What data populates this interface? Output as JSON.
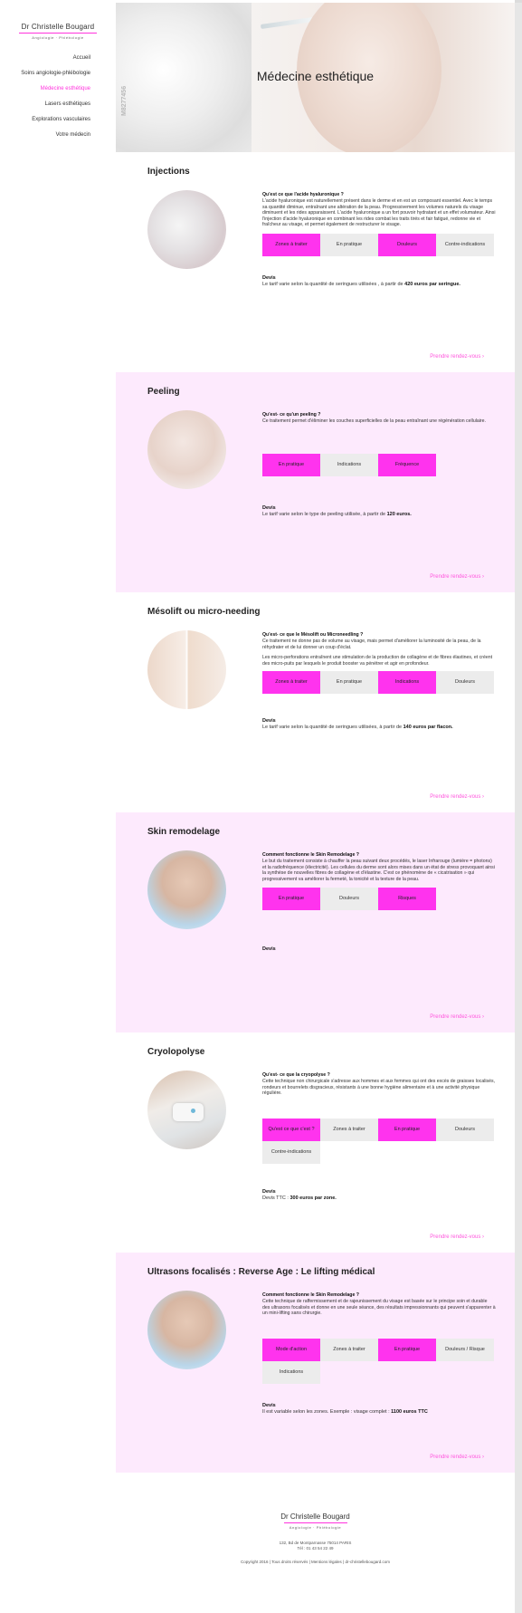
{
  "brand": {
    "name": "Dr Christelle Bougard",
    "subtitle": "Angiologie · Phlébologie"
  },
  "nav": [
    {
      "label": "Accueil"
    },
    {
      "label": "Soins angiologie-phlébologie"
    },
    {
      "label": "Médecine esthétique"
    },
    {
      "label": "Lasers esthétiques"
    },
    {
      "label": "Explorations vasculaires"
    },
    {
      "label": "Votre médecin"
    }
  ],
  "hero": {
    "title": "Médecine esthétique",
    "watermark": "M8277456"
  },
  "sections": [
    {
      "title": "Injections",
      "question": "Qu'est ce que l'acide hyaluronique ?",
      "paragraphs": [
        "L'acide hyaluronique est naturellement présent dans le derme et en est un composant essentiel. Avec le temps sa quantité diminue, entraînant une altération de la peau. Progressivement les volumes naturels du visage diminuent et les rides apparaissent. L'acide hyaluronique a un fort pouvoir hydratant et un effet volumateur. Ainsi l'injection d'acide hyaluronique en combinant les rides combat les traits tirés et fair fatigué, redonne vie et fraîcheur au visage, et permet également de restructurer le visage."
      ],
      "tabs": [
        "Zones à traiter",
        "En pratique",
        "Douleurs",
        "Contre-indications"
      ],
      "devis_title": "Devis",
      "devis_text": "Le tarif varie selon la quantité de seringues utilisées , à partir de",
      "devis_bold": "420 euros par seringue.",
      "cta": "Prendre rendez-vous ›"
    },
    {
      "title": "Peeling",
      "question": "Qu'est- ce qu'un peeling ?",
      "paragraphs": [
        "Ce traitement permet d'éliminer les couches superficielles de la peau entraînant une régénération cellulaire."
      ],
      "tabs": [
        "En pratique",
        "Indications",
        "Fréquence"
      ],
      "devis_title": "Devis",
      "devis_text": "Le tarif varie selon le type de peeling utilisée, à partir de",
      "devis_bold": "120 euros.",
      "cta": "Prendre rendez-vous ›"
    },
    {
      "title": "Mésolift ou micro-needing",
      "question": "Qu'est- ce que le Mésolift ou Microneedling ?",
      "paragraphs": [
        "Ce traitement ne donne pas de volume au visage, mais permet d'améliorer la luminosité de la peau, de la réhydrater et de lui donner un coup d'éclat.",
        "Les micro-perforations entraînent une stimulation de la production de collagène et de fibres élastines, et créent des micro-puits par lesquels le produit booster va pénétrer et agir en profondeur."
      ],
      "tabs": [
        "Zones à traiter",
        "En pratique",
        "Indications",
        "Douleurs"
      ],
      "devis_title": "Devis",
      "devis_text": "Le tarif varie selon la quantité de seringues utilisées, à partir de",
      "devis_bold": "140 euros par flacon.",
      "cta": "Prendre rendez-vous ›"
    },
    {
      "title": "Skin remodelage",
      "question": "Comment fonctionne le Skin Remodelage ?",
      "paragraphs": [
        "Le but du traitement consiste à chauffer la peau suivant deux procédés, le laser Infrarouge (lumière = photons) et la radiofréquence (électricité). Les cellules du derme sont alors mises dans un état de stress provoquant ainsi la synthèse de nouvelles fibres de collagène et d'élastine. C'est ce phénomène de « cicatrisation » qui progressivement va améliorer la fermeté, la tonicité et la texture de la peau."
      ],
      "tabs": [
        "En pratique",
        "Douleurs",
        "Risques"
      ],
      "devis_title": "Devis",
      "devis_text": "",
      "devis_bold": "",
      "cta": "Prendre rendez-vous ›"
    },
    {
      "title": "Cryolopolyse",
      "question": "Qu'est- ce que la cryopolyse ?",
      "paragraphs": [
        "Cette technique non chirurgicale s'adresse aux hommes et aux femmes qui ont des excès de graisses localisés, rondeurs et bourrelets disgracieux, résistants à une bonne hygiène alimentaire et à une activité physique régulière."
      ],
      "tabs": [
        "Qu'est ce que c'est ?",
        "Zones à traiter",
        "En pratique",
        "Douleurs",
        "Contre-indications"
      ],
      "devis_title": "Devis",
      "devis_text": "Devis TTC :",
      "devis_bold": "300 euros par zone.",
      "cta": "Prendre rendez-vous ›"
    },
    {
      "title": "Ultrasons focalisés : Reverse Age : Le lifting médical",
      "question": "Comment fonctionne le Skin Remodelage ?",
      "paragraphs": [
        "Cette technique de raffermissement et de rajeunissement du visage est basée sur le principe soin et durable des ultrasons focalisés et donne en une seule séance, des résultats impressionnants qui peuvent s'apparenter à un mini-lifting sans chirurgie."
      ],
      "tabs": [
        "Mode d'action",
        "Zones à traiter",
        "En pratique",
        "Douleurs / Risque",
        "Indications"
      ],
      "devis_title": "Devis",
      "devis_text": "Il est variable selon les zones. Exemple : visage complet :",
      "devis_bold": "1100 euros TTC",
      "cta": "Prendre rendez-vous ›"
    }
  ],
  "footer": {
    "name": "Dr Christelle Bougard",
    "subtitle": "Angiologie · Phlébologie",
    "address": "132, Bd de Montparnasse 75014 PARIS",
    "phone": "Tél : 01 43 54 22 49",
    "copyright": "Copyright 2016 | Tous droits réservés | Mentions légales | dr-christellebougard.com"
  }
}
